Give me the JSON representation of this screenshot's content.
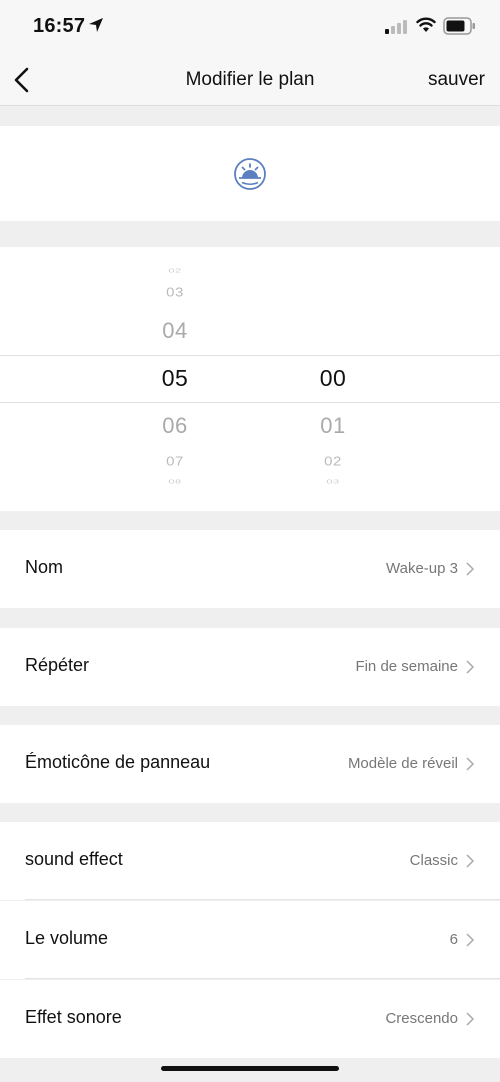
{
  "status_bar": {
    "time": "16:57"
  },
  "nav": {
    "title": "Modifier le plan",
    "save_label": "sauver"
  },
  "icon_panel": {
    "icon": "sunrise-icon"
  },
  "picker": {
    "hours": {
      "far_above": "02",
      "above2": "03",
      "above1": "04",
      "selected": "05",
      "below1": "06",
      "below2": "07",
      "far_below": "08"
    },
    "minutes": {
      "selected": "00",
      "below1": "01",
      "below2": "02",
      "far_below": "03"
    }
  },
  "settings": [
    {
      "label": "Nom",
      "value": "Wake-up 3"
    },
    {
      "label": "Répéter",
      "value": "Fin de semaine"
    },
    {
      "label": "Émoticône de panneau",
      "value": "Modèle de réveil"
    },
    {
      "label": "sound effect",
      "value": "Classic"
    },
    {
      "label": "Le volume",
      "value": "6"
    },
    {
      "label": "Effet sonore",
      "value": "Crescendo"
    }
  ],
  "colors": {
    "accent_icon": "#5b7fc0",
    "background": "#efefef"
  }
}
